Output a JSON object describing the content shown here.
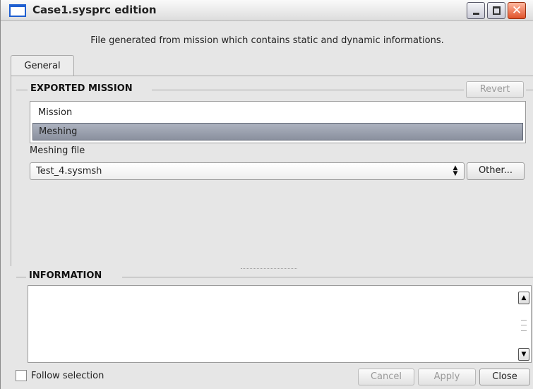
{
  "window": {
    "title": "Case1.sysprc edition",
    "description": "File generated from mission which contains static and dynamic informations."
  },
  "icons": {
    "app": "window-icon",
    "minimize": "minimize-icon",
    "maximize": "maximize-icon",
    "close": "close-icon",
    "combo": "up-down-arrows-icon",
    "scroll_up": "arrow-up-icon",
    "scroll_down": "arrow-down-icon"
  },
  "tabs": [
    {
      "label": "General",
      "active": true
    }
  ],
  "exported_mission": {
    "title": "EXPORTED MISSION",
    "revert_label": "Revert",
    "items": [
      {
        "label": "Mission",
        "selected": false
      },
      {
        "label": "Meshing",
        "selected": true
      }
    ],
    "meshing_file_label": "Meshing file",
    "meshing_file_value": "Test_4.sysmsh",
    "other_label": "Other..."
  },
  "information": {
    "title": "INFORMATION",
    "content": ""
  },
  "footer": {
    "follow_selection_label": "Follow selection",
    "follow_selection_checked": false,
    "cancel_label": "Cancel",
    "apply_label": "Apply",
    "close_label": "Close"
  },
  "colors": {
    "selected_item": "#8a909e",
    "close_button": "#e0522a",
    "app_icon_accent": "#1f5fd0"
  }
}
